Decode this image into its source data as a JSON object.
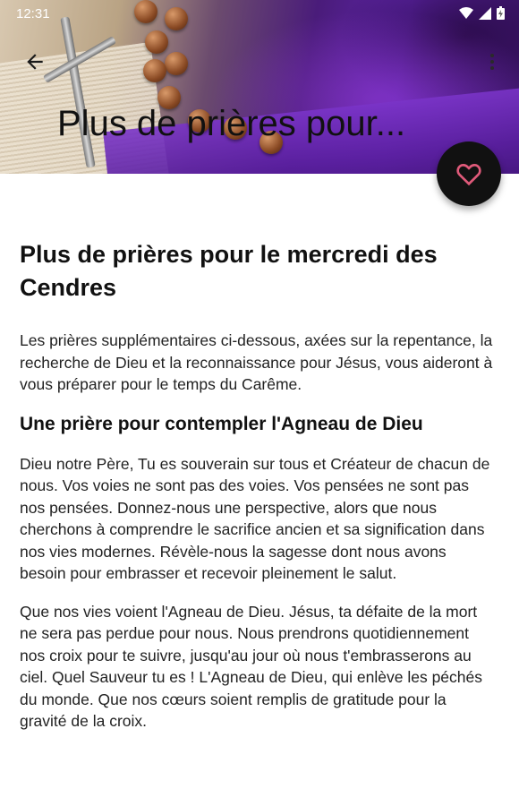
{
  "status_bar": {
    "time": "12:31"
  },
  "app_bar": {
    "title": "Plus de prières pour...",
    "back_icon": "arrow-back-icon",
    "menu_icon": "more-vert-icon"
  },
  "fab": {
    "icon": "heart-outline-icon",
    "color": "#111111",
    "icon_color": "#e05a7a"
  },
  "article": {
    "title": "Plus de prières pour le mercredi des Cendres",
    "intro": "Les prières supplémentaires ci-dessous, axées sur la repentance, la recherche de Dieu et la reconnaissance pour Jésus, vous aideront à vous préparer pour le temps du Carême.",
    "section_heading": "Une prière pour contempler l'Agneau de Dieu",
    "paragraph1": "Dieu notre Père, Tu es souverain sur tous et Créateur de chacun de nous. Vos voies ne sont pas des voies. Vos pensées ne sont pas nos pensées. Donnez-nous une perspective, alors que nous cherchons à comprendre le sacrifice ancien et sa signification dans nos vies modernes. Révèle-nous la sagesse dont nous avons besoin pour embrasser et recevoir pleinement le salut.",
    "paragraph2": "Que nos vies voient l'Agneau de Dieu. Jésus, ta défaite de la mort ne sera pas perdue pour nous. Nous prendrons quotidiennement nos croix pour te suivre, jusqu'au jour où nous t'embrasserons au ciel. Quel Sauveur tu es ! L'Agneau de Dieu, qui enlève les péchés du monde. Que nos cœurs soient remplis de gratitude pour la gravité de la croix."
  }
}
